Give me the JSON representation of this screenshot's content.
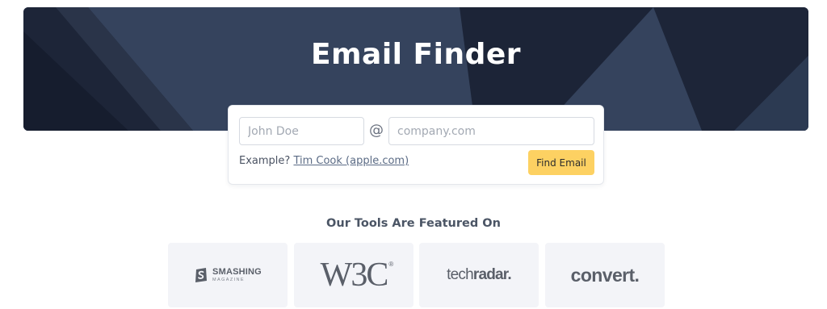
{
  "hero": {
    "title": "Email Finder",
    "background_color": "#35435d",
    "dark_shape_color": "#1c2437"
  },
  "search": {
    "name_placeholder": "John Doe",
    "name_value": "",
    "at_symbol": "@",
    "domain_placeholder": "company.com",
    "domain_value": "",
    "example_label": "Example?",
    "example_link": "Tim Cook (apple.com)",
    "button_label": "Find Email",
    "button_color": "#fdd162"
  },
  "featured": {
    "heading": "Our Tools Are Featured On",
    "logos": [
      {
        "name": "SMASHING",
        "sub": "MAGAZINE",
        "icon": "smashing-logo-icon"
      },
      {
        "name": "W3C",
        "mark": "®",
        "icon": "w3c-logo-icon"
      },
      {
        "name_light": "tech",
        "name_bold": "radar",
        "suffix": ".",
        "icon": "techradar-logo-icon"
      },
      {
        "name": "conv",
        "name_tail": "ert",
        "suffix": ".",
        "icon": "convert-logo-icon"
      }
    ],
    "card_color": "#f3f4f8"
  }
}
